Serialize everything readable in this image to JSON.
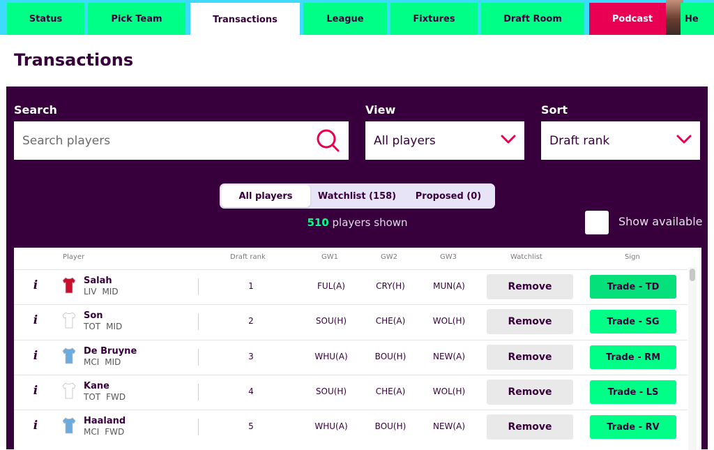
{
  "nav": {
    "tabs": [
      {
        "label": "Status"
      },
      {
        "label": "Pick Team"
      },
      {
        "label": "Transactions"
      },
      {
        "label": "League"
      },
      {
        "label": "Fixtures"
      },
      {
        "label": "Draft Room"
      },
      {
        "label": "Podcast"
      },
      {
        "label": "He"
      }
    ],
    "active_tab": "Transactions",
    "colors": {
      "tab": "#00ff87",
      "podcast": "#e90052",
      "bar": "#3ddcff",
      "text": "#37003c"
    }
  },
  "page": {
    "title": "Transactions"
  },
  "filters": {
    "search": {
      "label": "Search",
      "placeholder": "Search players",
      "icon": "search-icon"
    },
    "view": {
      "label": "View",
      "value": "All players",
      "icon": "chevron-down-icon"
    },
    "sort": {
      "label": "Sort",
      "value": "Draft rank",
      "icon": "chevron-down-icon"
    }
  },
  "segments": {
    "options": [
      "All players",
      "Watchlist (158)",
      "Proposed (0)"
    ],
    "selected": "All players"
  },
  "count": {
    "number": "510",
    "suffix": "players shown"
  },
  "show_available": {
    "label": "Show available",
    "checked": false
  },
  "table": {
    "headers": {
      "player": "Player",
      "draft_rank": "Draft rank",
      "gw1": "GW1",
      "gw2": "GW2",
      "gw3": "GW3",
      "watchlist": "Watchlist",
      "sign": "Sign"
    },
    "rows": [
      {
        "info": "i",
        "name": "Salah",
        "team": "LIV",
        "pos": "MID",
        "rank": "1",
        "gw1": "FUL(A)",
        "gw2": "CRY(H)",
        "gw3": "MUN(A)",
        "watchlist": "Remove",
        "sign": "Trade - TD",
        "kit": "#c8102e"
      },
      {
        "info": "i",
        "name": "Son",
        "team": "TOT",
        "pos": "MID",
        "rank": "2",
        "gw1": "SOU(H)",
        "gw2": "CHE(A)",
        "gw3": "WOL(H)",
        "watchlist": "Remove",
        "sign": "Trade - SG",
        "kit": "#ffffff"
      },
      {
        "info": "i",
        "name": "De Bruyne",
        "team": "MCI",
        "pos": "MID",
        "rank": "3",
        "gw1": "WHU(A)",
        "gw2": "BOU(H)",
        "gw3": "NEW(A)",
        "watchlist": "Remove",
        "sign": "Trade - RM",
        "kit": "#6cabdd"
      },
      {
        "info": "i",
        "name": "Kane",
        "team": "TOT",
        "pos": "FWD",
        "rank": "4",
        "gw1": "SOU(H)",
        "gw2": "CHE(A)",
        "gw3": "WOL(H)",
        "watchlist": "Remove",
        "sign": "Trade - LS",
        "kit": "#ffffff"
      },
      {
        "info": "i",
        "name": "Haaland",
        "team": "MCI",
        "pos": "FWD",
        "rank": "5",
        "gw1": "WHU(A)",
        "gw2": "BOU(H)",
        "gw3": "NEW(A)",
        "watchlist": "Remove",
        "sign": "Trade - RV",
        "kit": "#6cabdd"
      }
    ]
  }
}
